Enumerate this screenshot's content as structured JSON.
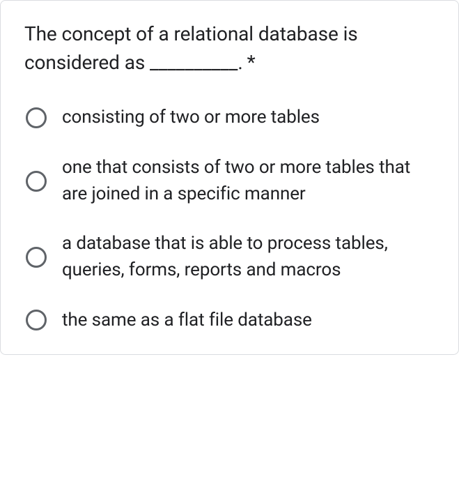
{
  "question": {
    "text_before_blank": "The concept of a relational database is considered as ",
    "blank": "__________",
    "dot": ".",
    "required_marker": "*"
  },
  "options": [
    {
      "label": "consisting of two or more tables"
    },
    {
      "label": "one that consists of two or more tables that are joined in a specific manner"
    },
    {
      "label": "a database that is able to process tables, queries, forms, reports and macros"
    },
    {
      "label": "the same as a flat file database"
    }
  ]
}
